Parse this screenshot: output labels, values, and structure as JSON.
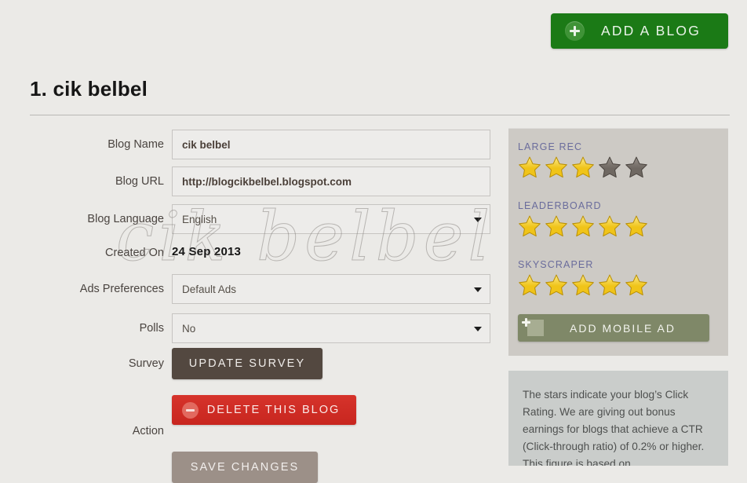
{
  "topbar": {
    "add_blog_label": "ADD A BLOG",
    "add_blog_icon": "plus-circle-icon"
  },
  "page": {
    "title": "1. cik belbel",
    "watermark": "cik belbel"
  },
  "form": {
    "rows": [
      {
        "label": "Blog Name",
        "type": "text",
        "value": "cik belbel"
      },
      {
        "label": "Blog URL",
        "type": "text",
        "value": "http://blogcikbelbel.blogspot.com"
      },
      {
        "label": "Blog Language",
        "type": "select",
        "value": "English"
      },
      {
        "label": "Created On",
        "type": "static",
        "value": "24 Sep 2013"
      },
      {
        "label": "Ads Preferences",
        "type": "select",
        "value": "Default Ads"
      },
      {
        "label": "Polls",
        "type": "select",
        "value": "No"
      },
      {
        "label": "Survey",
        "type": "button",
        "value": "UPDATE SURVEY"
      },
      {
        "label": "Action",
        "type": "actions",
        "value": ""
      }
    ],
    "buttons": {
      "update_survey": "UPDATE SURVEY",
      "delete_blog": "DELETE THIS BLOG",
      "delete_blog_icon": "minus-circle-icon",
      "save_changes": "SAVE CHANGES"
    }
  },
  "sidebar": {
    "ad_units": [
      {
        "name": "LARGE REC",
        "rating": 3,
        "max": 5
      },
      {
        "name": "LEADERBOARD",
        "rating": 5,
        "max": 5
      },
      {
        "name": "SKYSCRAPER",
        "rating": 5,
        "max": 5
      }
    ],
    "add_mobile_ad_label": "ADD MOBILE AD",
    "add_mobile_ad_icon": "plus-circle-icon",
    "info_text": "The stars indicate your blog’s Click Rating. We are giving out bonus earnings for blogs that achieve a CTR (Click-through ratio) of 0.2% or higher. This figure is based on"
  },
  "colors": {
    "page_background": "#ebeae7",
    "add_blog_green": "#1b7a16",
    "delete_red": "#cf2d26",
    "survey_brown": "#534840",
    "save_gray": "#9c9088",
    "mobile_ad_olive": "#7f8868",
    "ad_panel_gray": "#cdcac5",
    "info_panel_gray": "#cacdcb",
    "star_gold": "#f0c419",
    "star_gray": "#6f6862",
    "ad_title_blue": "#6a6c9c"
  }
}
